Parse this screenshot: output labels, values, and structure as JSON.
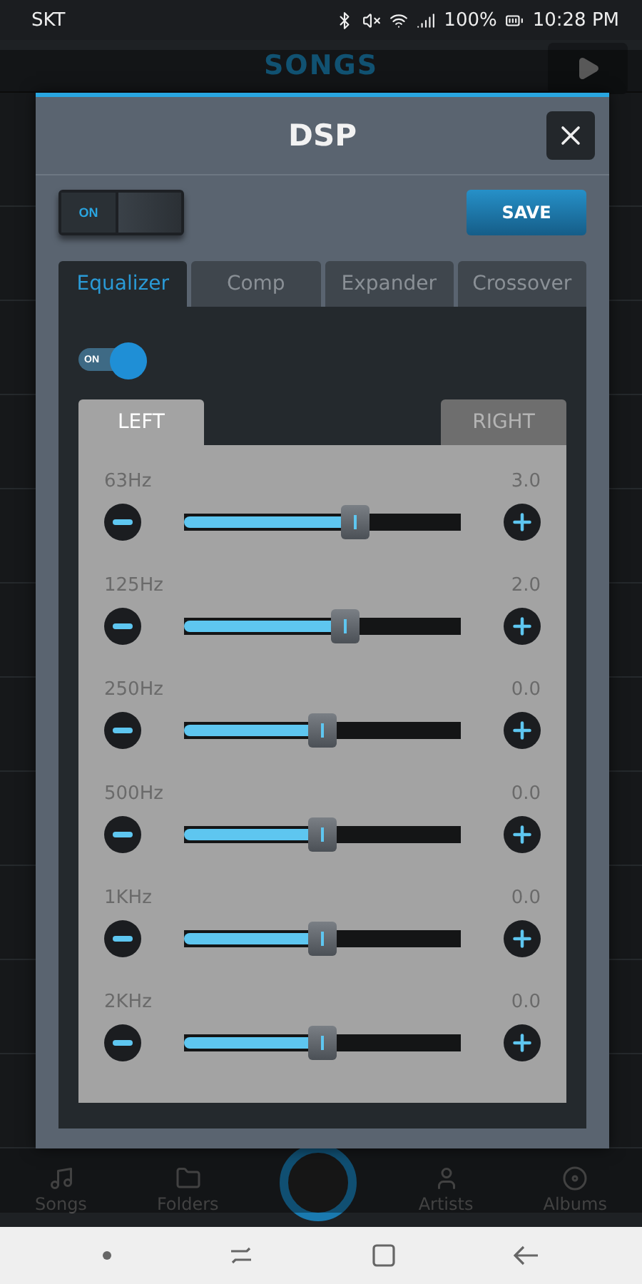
{
  "status_bar": {
    "carrier": "SKT",
    "battery": "100%",
    "time": "10:28 PM"
  },
  "header": {
    "title": "SONGS"
  },
  "dialog": {
    "title": "DSP",
    "master_switch": {
      "label": "ON",
      "on": true
    },
    "save_button": "SAVE",
    "tabs": [
      {
        "label": "Equalizer",
        "selected": true
      },
      {
        "label": "Comp",
        "selected": false
      },
      {
        "label": "Expander",
        "selected": false
      },
      {
        "label": "Crossover",
        "selected": false
      }
    ],
    "eq_switch": {
      "label": "ON",
      "on": true
    },
    "channel_tabs": [
      {
        "label": "LEFT",
        "selected": true
      },
      {
        "label": "RIGHT",
        "selected": false
      }
    ],
    "bands": [
      {
        "label": "63Hz",
        "reading": "3.0",
        "level": 0.62
      },
      {
        "label": "125Hz",
        "reading": "2.0",
        "level": 0.58
      },
      {
        "label": "250Hz",
        "reading": "0.0",
        "level": 0.5
      },
      {
        "label": "500Hz",
        "reading": "0.0",
        "level": 0.5
      },
      {
        "label": "1KHz",
        "reading": "0.0",
        "level": 0.5
      },
      {
        "label": "2KHz",
        "reading": "0.0",
        "level": 0.5
      }
    ]
  },
  "bottom_nav": [
    {
      "kind": "tab",
      "label": "Songs"
    },
    {
      "kind": "tab",
      "label": "Folders"
    },
    {
      "kind": "center"
    },
    {
      "kind": "tab",
      "label": "Artists"
    },
    {
      "kind": "tab",
      "label": "Albums"
    }
  ]
}
